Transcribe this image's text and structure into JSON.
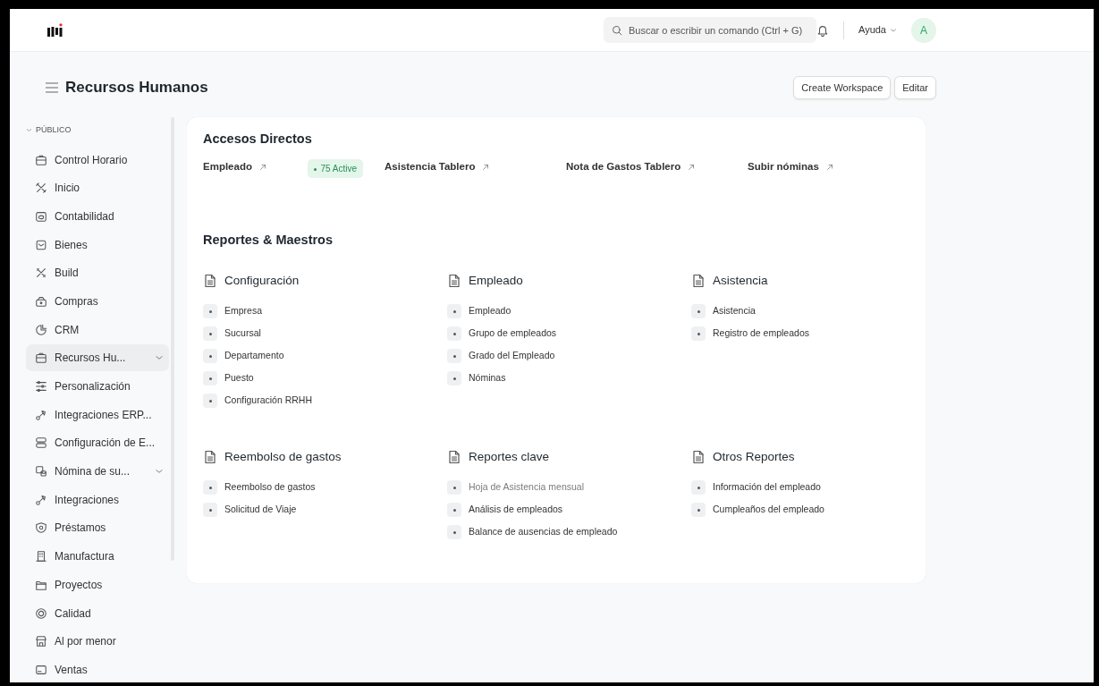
{
  "navbar": {
    "search": {
      "placeholder": "Buscar o escribir un comando (Ctrl + G)"
    },
    "help_menu": "Ayuda",
    "avatar": "A"
  },
  "page": {
    "title": "Recursos Humanos",
    "buttons": [
      "Create Workspace",
      "Editar"
    ]
  },
  "sidebar": {
    "section": "PÚBLICO",
    "section_expanded": true,
    "items": [
      {
        "label": "Control Horario",
        "selected": false,
        "expandable": false
      },
      {
        "label": "Inicio",
        "selected": false,
        "expandable": false
      },
      {
        "label": "Contabilidad",
        "selected": false,
        "expandable": false
      },
      {
        "label": "Bienes",
        "selected": false,
        "expandable": false
      },
      {
        "label": "Build",
        "selected": false,
        "expandable": false
      },
      {
        "label": "Compras",
        "selected": false,
        "expandable": false
      },
      {
        "label": "CRM",
        "selected": false,
        "expandable": false
      },
      {
        "label": "Recursos Hu...",
        "selected": true,
        "expandable": true
      },
      {
        "label": "Personalización",
        "selected": false,
        "expandable": false
      },
      {
        "label": "Integraciones ERP...",
        "selected": false,
        "expandable": false
      },
      {
        "label": "Configuración de E...",
        "selected": false,
        "expandable": false
      },
      {
        "label": "Nómina de su...",
        "selected": false,
        "expandable": true
      },
      {
        "label": "Integraciones",
        "selected": false,
        "expandable": false
      },
      {
        "label": "Préstamos",
        "selected": false,
        "expandable": false
      },
      {
        "label": "Manufactura",
        "selected": false,
        "expandable": false
      },
      {
        "label": "Proyectos",
        "selected": false,
        "expandable": false
      },
      {
        "label": "Calidad",
        "selected": false,
        "expandable": false
      },
      {
        "label": "Al por menor",
        "selected": false,
        "expandable": false
      },
      {
        "label": "Ventas",
        "selected": false,
        "expandable": false
      }
    ]
  },
  "shortcuts": {
    "title": "Accesos Directos",
    "links": [
      {
        "label": "Empleado",
        "badge": "75 Active"
      },
      {
        "label": "Asistencia Tablero"
      },
      {
        "label": "Nota de Gastos Tablero"
      },
      {
        "label": "Subir nóminas"
      }
    ]
  },
  "reports": {
    "title": "Reportes & Maestros",
    "groups": [
      {
        "title": "Configuración",
        "items": [
          {
            "label": "Empresa",
            "disabled": false
          },
          {
            "label": "Sucursal",
            "disabled": false
          },
          {
            "label": "Departamento",
            "disabled": false
          },
          {
            "label": "Puesto",
            "disabled": false
          },
          {
            "label": "Configuración RRHH",
            "disabled": false
          }
        ]
      },
      {
        "title": "Empleado",
        "items": [
          {
            "label": "Empleado",
            "disabled": false
          },
          {
            "label": "Grupo de empleados",
            "disabled": false
          },
          {
            "label": "Grado del Empleado",
            "disabled": false
          },
          {
            "label": "Nóminas",
            "disabled": false
          }
        ]
      },
      {
        "title": "Asistencia",
        "items": [
          {
            "label": "Asistencia",
            "disabled": false
          },
          {
            "label": "Registro de empleados",
            "disabled": false
          }
        ]
      },
      {
        "title": "Reembolso de gastos",
        "items": [
          {
            "label": "Reembolso de gastos",
            "disabled": false
          },
          {
            "label": "Solicitud de Viaje",
            "disabled": false
          }
        ]
      },
      {
        "title": "Reportes clave",
        "items": [
          {
            "label": "Hoja de Asistencia mensual",
            "disabled": true
          },
          {
            "label": "Análisis de empleados",
            "disabled": false
          },
          {
            "label": "Balance de ausencias de empleado",
            "disabled": false
          }
        ]
      },
      {
        "title": "Otros Reportes",
        "items": [
          {
            "label": "Información del empleado",
            "disabled": false
          },
          {
            "label": "Cumpleaños del empleado",
            "disabled": false
          }
        ]
      }
    ]
  }
}
